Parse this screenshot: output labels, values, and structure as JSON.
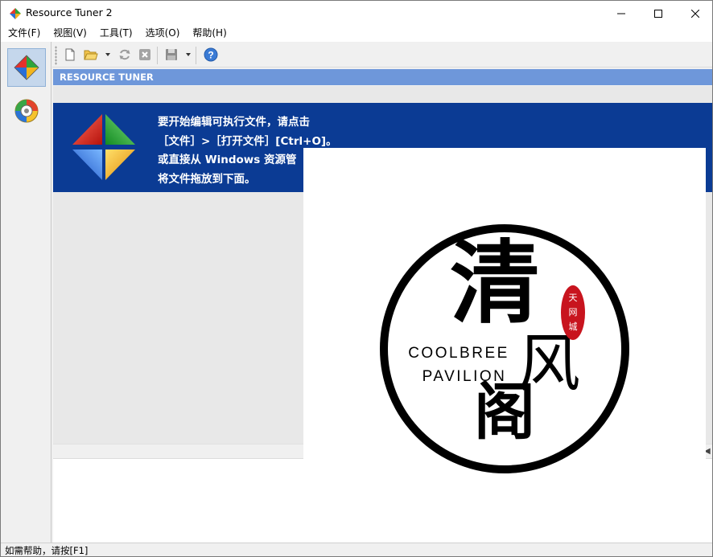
{
  "window": {
    "title": "Resource Tuner 2"
  },
  "menu": [
    "文件(F)",
    "视图(V)",
    "工具(T)",
    "选项(O)",
    "帮助(H)"
  ],
  "left_panel": {
    "items": [
      {
        "name": "resource-tuner-view",
        "icon": "colored-diamond-icon",
        "selected": true
      },
      {
        "name": "resource-explorer-view",
        "icon": "color-wheel-icon",
        "selected": false
      }
    ]
  },
  "toolbar": {
    "buttons": [
      "new-file-icon",
      "open-folder-icon",
      "refresh-icon",
      "close-file-icon",
      "save-icon",
      "help-icon"
    ]
  },
  "section": {
    "header": "RESOURCE TUNER"
  },
  "banner": {
    "line1": "要开始编辑可执行文件，请点击",
    "line2": "［文件］>［打开文件］[Ctrl+O]。",
    "line3": "或直接从 Windows 资源管",
    "line4": "将文件拖放到下面。"
  },
  "logo_image": {
    "big_char_1": "清",
    "big_char_2": "风",
    "big_char_3": "阁",
    "seal_text": "天网城",
    "english_line1": "COOLBREE",
    "english_line2": "PAVILION"
  },
  "status": {
    "text": "如需帮助，请按[F1]"
  },
  "colors": {
    "section_header": "#6e97da",
    "banner": "#0b3b94",
    "selected_item": "#c5d7ec",
    "seal_red": "#c8141e"
  }
}
